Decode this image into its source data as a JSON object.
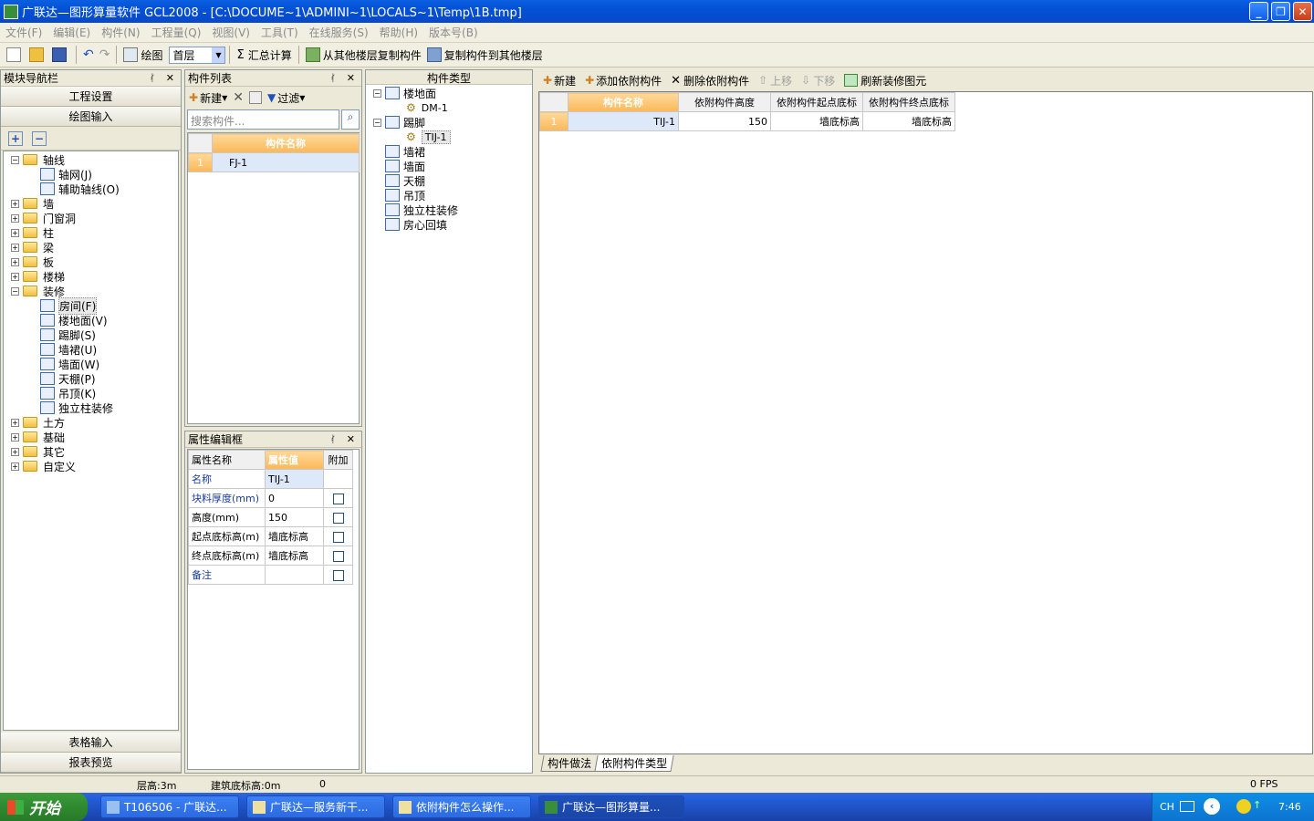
{
  "window": {
    "title": "广联达—图形算量软件 GCL2008 - [C:\\DOCUME~1\\ADMINI~1\\LOCALS~1\\Temp\\1B.tmp]",
    "minimize": "_",
    "restore": "❐",
    "close": "✕"
  },
  "menu": [
    "文件(F)",
    "编辑(E)",
    "构件(N)",
    "工程量(Q)",
    "视图(V)",
    "工具(T)",
    "在线服务(S)",
    "帮助(H)",
    "版本号(B)"
  ],
  "toolbar": {
    "draw": "绘图",
    "floor": "首层",
    "sum": "汇总计算",
    "copy_from": "从其他楼层复制构件",
    "copy_to": "复制构件到其他楼层"
  },
  "nav": {
    "title": "模块导航栏",
    "project_settings": "工程设置",
    "drawing_input": "绘图输入",
    "table_input": "表格输入",
    "report_preview": "报表预览",
    "tree": [
      {
        "label": "轴线",
        "level": 0,
        "expanded": true
      },
      {
        "label": "轴网(J)",
        "level": 1
      },
      {
        "label": "辅助轴线(O)",
        "level": 1
      },
      {
        "label": "墙",
        "level": 0
      },
      {
        "label": "门窗洞",
        "level": 0
      },
      {
        "label": "柱",
        "level": 0
      },
      {
        "label": "梁",
        "level": 0
      },
      {
        "label": "板",
        "level": 0
      },
      {
        "label": "楼梯",
        "level": 0
      },
      {
        "label": "装修",
        "level": 0,
        "expanded": true
      },
      {
        "label": "房间(F)",
        "level": 1,
        "selected": true
      },
      {
        "label": "楼地面(V)",
        "level": 1
      },
      {
        "label": "踢脚(S)",
        "level": 1
      },
      {
        "label": "墙裙(U)",
        "level": 1
      },
      {
        "label": "墙面(W)",
        "level": 1
      },
      {
        "label": "天棚(P)",
        "level": 1
      },
      {
        "label": "吊顶(K)",
        "level": 1
      },
      {
        "label": "独立柱装修",
        "level": 1
      },
      {
        "label": "土方",
        "level": 0
      },
      {
        "label": "基础",
        "level": 0
      },
      {
        "label": "其它",
        "level": 0
      },
      {
        "label": "自定义",
        "level": 0
      }
    ]
  },
  "component_list": {
    "title": "构件列表",
    "new": "新建",
    "filter": "过滤",
    "search_placeholder": "搜索构件...",
    "col_name": "构件名称",
    "rows": [
      {
        "num": "1",
        "name": "FJ-1"
      }
    ]
  },
  "property": {
    "title": "属性编辑框",
    "col_name": "属性名称",
    "col_value": "属性值",
    "col_extra": "附加",
    "rows": [
      {
        "name": "名称",
        "value": "TIJ-1",
        "check": false
      },
      {
        "name": "块料厚度(mm)",
        "value": "0",
        "check": true
      },
      {
        "name": "高度(mm)",
        "value": "150",
        "check": true
      },
      {
        "name": "起点底标高(m)",
        "value": "墙底标高",
        "check": true
      },
      {
        "name": "终点底标高(m)",
        "value": "墙底标高",
        "check": true
      },
      {
        "name": "备注",
        "value": "",
        "check": true
      }
    ]
  },
  "component_type": {
    "title": "构件类型",
    "tree": [
      {
        "label": "楼地面",
        "level": 0
      },
      {
        "label": "DM-1",
        "level": 1
      },
      {
        "label": "踢脚",
        "level": 0
      },
      {
        "label": "TIJ-1",
        "level": 1,
        "selected": true
      },
      {
        "label": "墙裙",
        "level": 0
      },
      {
        "label": "墙面",
        "level": 0
      },
      {
        "label": "天棚",
        "level": 0
      },
      {
        "label": "吊顶",
        "level": 0
      },
      {
        "label": "独立柱装修",
        "level": 0
      },
      {
        "label": "房心回填",
        "level": 0
      }
    ]
  },
  "attached": {
    "toolbar": {
      "new": "新建",
      "add": "添加依附构件",
      "delete": "删除依附构件",
      "up": "上移",
      "down": "下移",
      "refresh": "刷新装修图元"
    },
    "headers": [
      "构件名称",
      "依附构件高度",
      "依附构件起点底标",
      "依附构件终点底标"
    ],
    "rows": [
      {
        "num": "1",
        "name": "TIJ-1",
        "height": "150",
        "start": "墙底标高",
        "end": "墙底标高"
      }
    ],
    "tabs": [
      "构件做法",
      "依附构件类型"
    ]
  },
  "status": {
    "floor_height": "层高:3m",
    "base_elev": "建筑底标高:0m",
    "zero": "0",
    "fps": "0 FPS"
  },
  "taskbar": {
    "start": "开始",
    "tasks": [
      "T106506 - 广联达...",
      "广联达—服务新干...",
      "依附构件怎么操作...",
      "广联达—图形算量..."
    ],
    "lang": "CH",
    "time": "7:46"
  }
}
